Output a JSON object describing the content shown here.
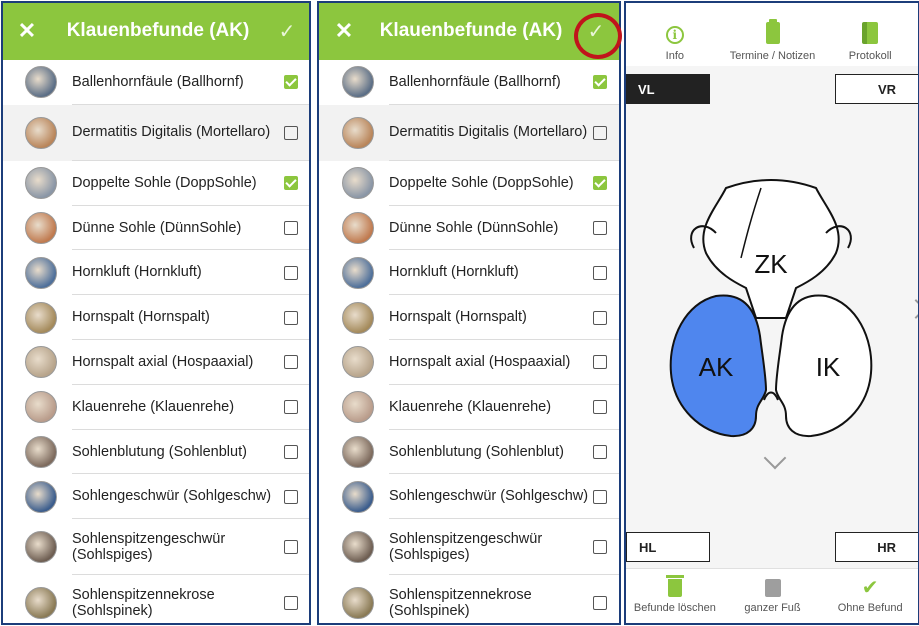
{
  "panels": [
    {
      "title": "Klauenbefunde (AK)",
      "close_icon": "✕",
      "confirm_icon": "✓",
      "items": [
        {
          "label": "Ballenhornfäule (Ballhornf)",
          "checked": true,
          "color": "#5b6e86"
        },
        {
          "label": "Dermatitis Digitalis (Mortellaro)",
          "checked": false,
          "color": "#b9855a"
        },
        {
          "label": "Doppelte Sohle (DoppSohle)",
          "checked": true,
          "color": "#8a96a6"
        },
        {
          "label": "Dünne Sohle (DünnSohle)",
          "checked": false,
          "color": "#c07a4f"
        },
        {
          "label": "Hornkluft (Hornkluft)",
          "checked": false,
          "color": "#4e6f9a"
        },
        {
          "label": "Hornspalt (Hornspalt)",
          "checked": false,
          "color": "#a48a5b"
        },
        {
          "label": "Hornspalt axial (Hospaaxial)",
          "checked": false,
          "color": "#b7a48b"
        },
        {
          "label": "Klauenrehe (Klauenrehe)",
          "checked": false,
          "color": "#b99c8b"
        },
        {
          "label": "Sohlenblutung (Sohlenblut)",
          "checked": false,
          "color": "#7d6a5d"
        },
        {
          "label": "Sohlengeschwür (Sohlgeschw)",
          "checked": false,
          "color": "#3b5d8d"
        },
        {
          "label": "Sohlenspitzengeschwür (Sohlspiges)",
          "checked": false,
          "color": "#6e5e52"
        },
        {
          "label": "Sohlenspitzennekrose (Sohlspinek)",
          "checked": false,
          "color": "#8a7a55"
        }
      ]
    }
  ],
  "hoof_view": {
    "tabs": [
      {
        "label": "Info",
        "icon": "info-icon"
      },
      {
        "label": "Termine / Notizen",
        "icon": "clipboard-icon"
      },
      {
        "label": "Protokoll",
        "icon": "book-icon"
      }
    ],
    "corners": {
      "vl": "VL",
      "vr": "VR",
      "hl": "HL",
      "hr": "HR"
    },
    "zones": {
      "zk": "ZK",
      "ak": "AK",
      "ik": "IK"
    },
    "bottom": [
      {
        "label": "Befunde löschen",
        "icon": "trash-icon"
      },
      {
        "label": "ganzer Fuß",
        "icon": "pen-icon"
      },
      {
        "label": "Ohne Befund",
        "icon": "double-check-icon"
      }
    ],
    "colors": {
      "accent": "#8cc63e",
      "selected_zone": "#4f86ee"
    }
  }
}
